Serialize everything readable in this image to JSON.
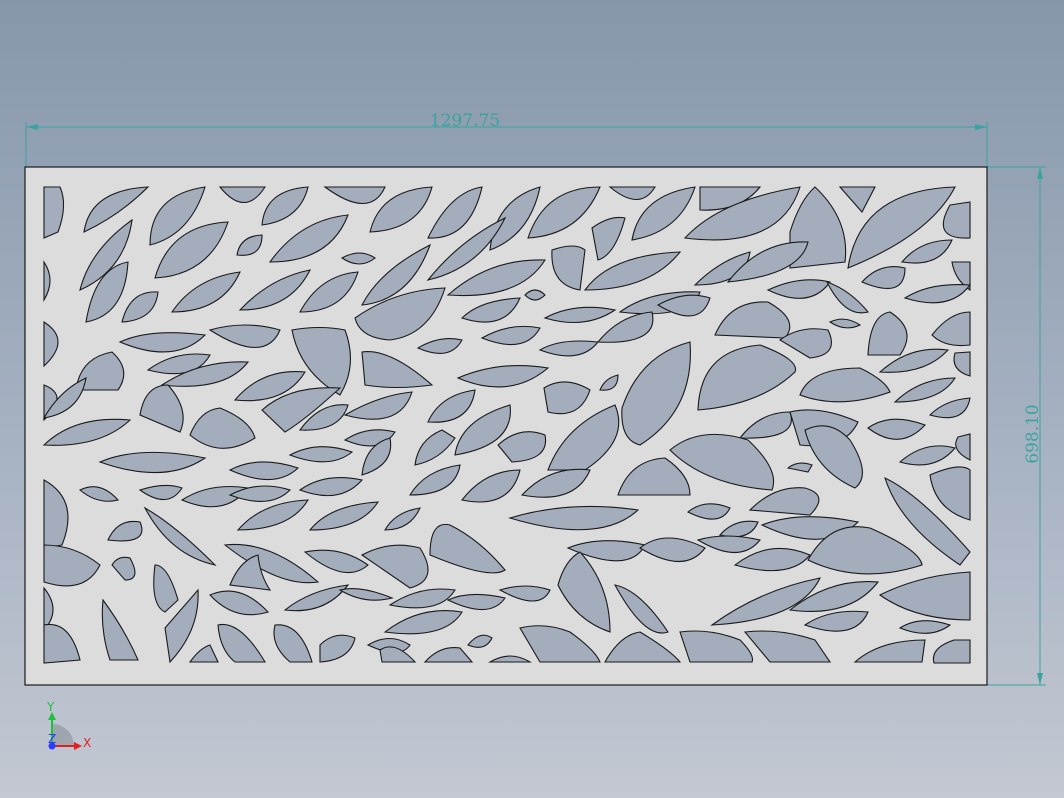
{
  "drawing": {
    "width_dimension": "1297.75",
    "height_dimension": "698.10",
    "dimension_color": "#3aa3a0",
    "background_top": "#8797ab",
    "background_bottom": "#c3c8d2",
    "panel_fill": "#dcdcdc",
    "cutout_fill": "#a3adbc",
    "outline_color": "#1a1a1a"
  },
  "triad": {
    "x_label": "X",
    "y_label": "Y",
    "z_label": "Z",
    "x_color": "#e02020",
    "y_color": "#1fbf3f",
    "z_color": "#2a3cff"
  }
}
